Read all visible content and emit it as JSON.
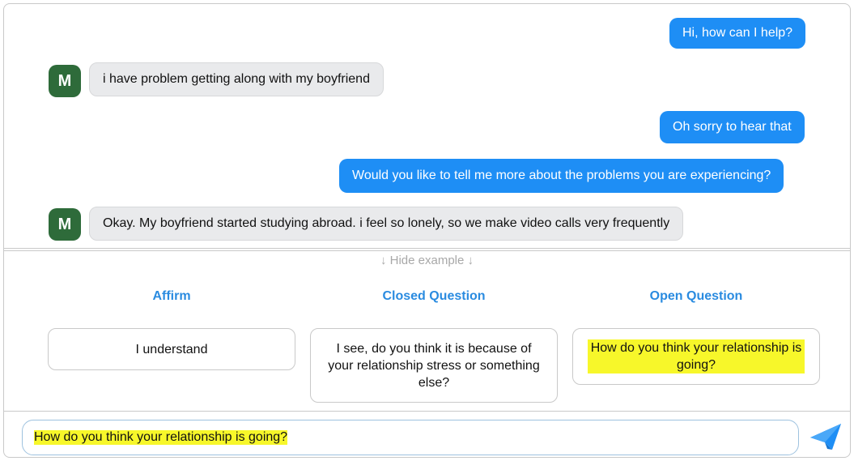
{
  "messages": [
    {
      "role": "bot",
      "text": "Hi, how can I help?"
    },
    {
      "role": "user",
      "avatar": "M",
      "text": "i have problem getting along with my boyfriend"
    },
    {
      "role": "bot",
      "text": "Oh sorry to hear that"
    },
    {
      "role": "bot",
      "text": "Would you like to tell me more about the problems you are experiencing?"
    },
    {
      "role": "user",
      "avatar": "M",
      "text": "Okay. My boyfriend started studying abroad. i feel so lonely, so we make video calls very frequently"
    }
  ],
  "examples": {
    "toggle_label": "↓ Hide example ↓",
    "categories": [
      {
        "title": "Affirm",
        "example": "I understand",
        "highlighted": false
      },
      {
        "title": "Closed Question",
        "example": "I see, do you think it is because of your relationship stress or something else?",
        "highlighted": false
      },
      {
        "title": "Open Question",
        "example": "How do you think your relationship is going?",
        "highlighted": true
      }
    ]
  },
  "input": {
    "value": "How do you think your relationship is going?",
    "highlight_color": "#f7f72a"
  },
  "send_icon": "paper-plane-icon",
  "colors": {
    "bot_bubble": "#1e8ef5",
    "user_bubble": "#e9eaec",
    "avatar": "#2e6b3a",
    "category_title": "#2a8be0"
  }
}
